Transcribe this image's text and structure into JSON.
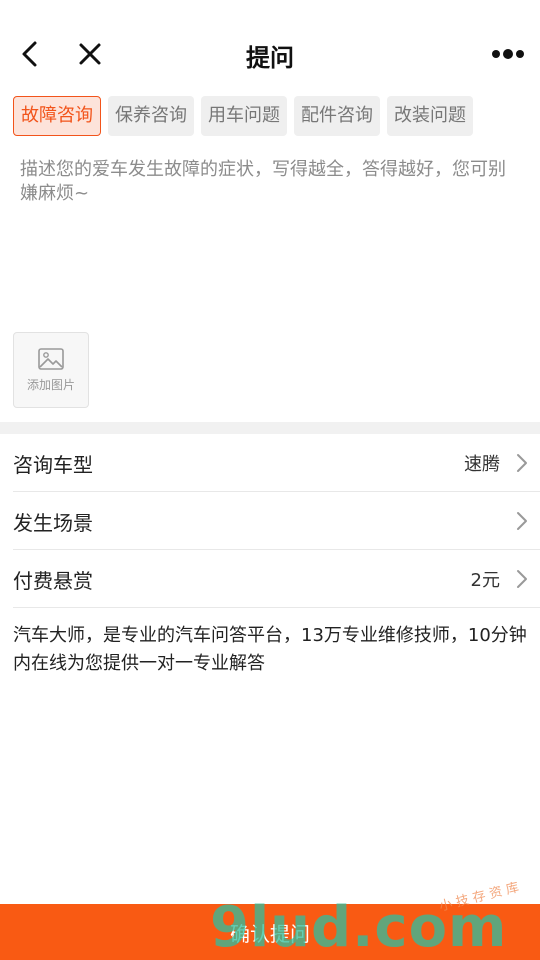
{
  "header": {
    "title": "提问",
    "back_icon": "chevron-left-icon",
    "close_icon": "close-icon",
    "more_icon": "more-dots-icon"
  },
  "tags": [
    {
      "label": "故障咨询",
      "active": true
    },
    {
      "label": "保养咨询",
      "active": false
    },
    {
      "label": "用车问题",
      "active": false
    },
    {
      "label": "配件咨询",
      "active": false
    },
    {
      "label": "改装问题",
      "active": false
    }
  ],
  "question": {
    "placeholder": "描述您的爱车发生故障的症状，写得越全，答得越好，您可别嫌麻烦~"
  },
  "add_image": {
    "label": "添加图片",
    "icon": "image-icon"
  },
  "rows": [
    {
      "label": "咨询车型",
      "value": "速腾"
    },
    {
      "label": "发生场景",
      "value": ""
    },
    {
      "label": "付费悬赏",
      "value": "2元"
    }
  ],
  "intro": "汽车大师，是专业的汽车问答平台，13万专业维修技师，10分钟内在线为您提供一对一专业解答",
  "submit_label": "确认提问",
  "watermark": {
    "main": "9lud.com",
    "sub": "小 技 存 资 库"
  },
  "colors": {
    "accent": "#f95a13",
    "tag_active_bg": "#fde3da",
    "tag_bg": "#efefef",
    "watermark": "#2fbf9e"
  }
}
